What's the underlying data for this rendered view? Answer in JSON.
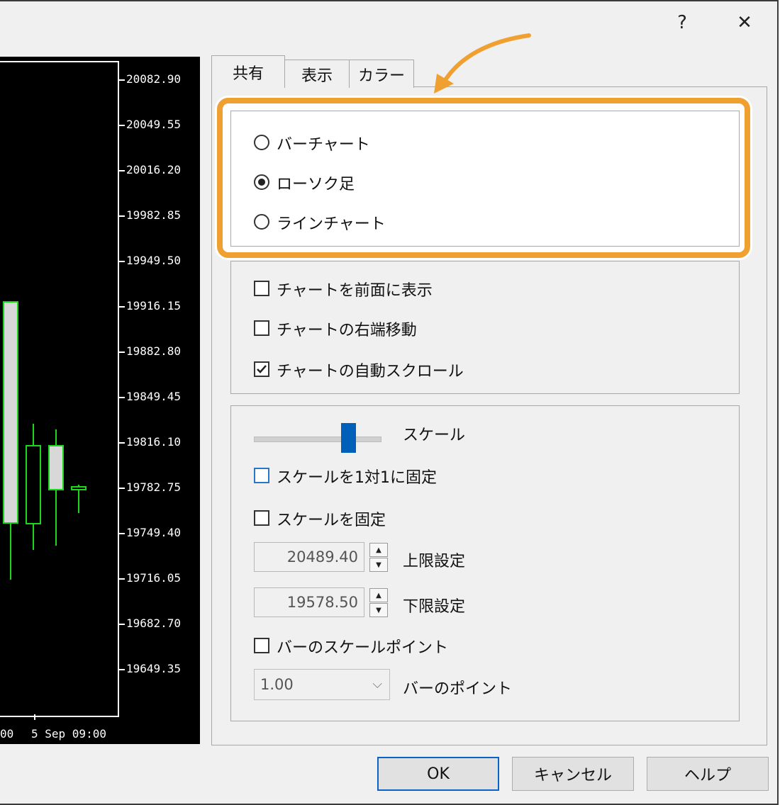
{
  "window": {
    "help_glyph": "?",
    "close_glyph": "✕"
  },
  "chart": {
    "y_labels": [
      "20082.90",
      "20049.55",
      "20016.20",
      "19982.85",
      "19949.50",
      "19916.15",
      "19882.80",
      "19849.45",
      "19816.10",
      "19782.75",
      "19749.40",
      "19716.05",
      "19682.70",
      "19649.35"
    ],
    "x_labels": [
      "00",
      "5 Sep 09:00"
    ],
    "colors": {
      "background": "#000000",
      "candle": "#1bd61b",
      "bear_fill": "#d8d8d8"
    }
  },
  "tabs": [
    {
      "label": "共有",
      "active": true
    },
    {
      "label": "表示",
      "active": false
    },
    {
      "label": "カラー",
      "active": false
    }
  ],
  "chart_type": {
    "options": [
      {
        "label": "バーチャート",
        "selected": false
      },
      {
        "label": "ローソク足",
        "selected": true
      },
      {
        "label": "ラインチャート",
        "selected": false
      }
    ]
  },
  "options": {
    "items": [
      {
        "label": "チャートを前面に表示",
        "checked": false
      },
      {
        "label": "チャートの右端移動",
        "checked": false
      },
      {
        "label": "チャートの自動スクロール",
        "checked": true
      }
    ]
  },
  "scale": {
    "label": "スケール",
    "level": 0.75,
    "fix_1to1_label": "スケールを1対1に固定",
    "fix_1to1_checked": false,
    "fix_label": "スケールを固定",
    "fix_checked": false,
    "upper_value": "20489.40",
    "upper_label": "上限設定",
    "lower_value": "19578.50",
    "lower_label": "下限設定",
    "bar_scale_label": "バーのスケールポイント",
    "bar_scale_checked": false,
    "bar_point_value": "1.00",
    "bar_point_label": "バーのポイント"
  },
  "buttons": {
    "ok": "OK",
    "cancel": "キャンセル",
    "help": "ヘルプ"
  },
  "accent": {
    "highlight": "#f0a030",
    "selection_blue": "#005fb8"
  }
}
